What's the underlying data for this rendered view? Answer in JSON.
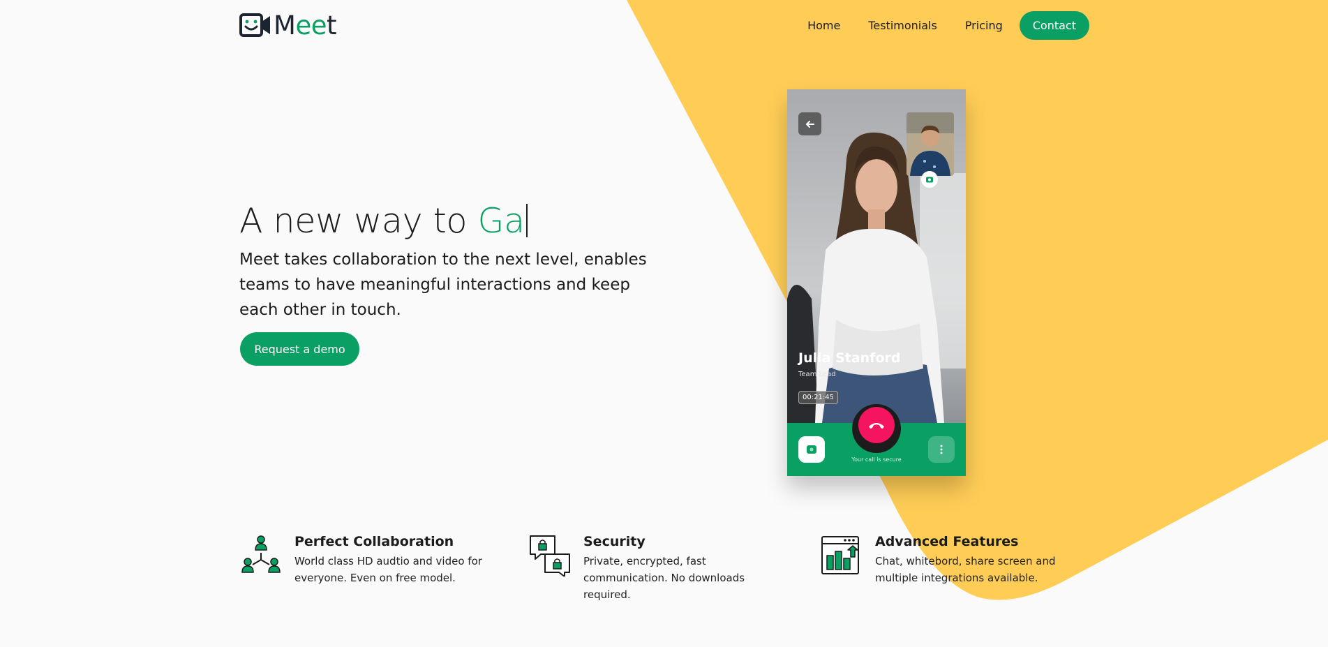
{
  "brand": {
    "logo_prefix": "M",
    "logo_highlight": "ee",
    "logo_suffix": "t",
    "accent": "#0aa063",
    "yellow": "#ffcd56"
  },
  "nav": {
    "home": "Home",
    "testimonials": "Testimonials",
    "pricing": "Pricing",
    "contact": "Contact"
  },
  "hero": {
    "title_static": "A new way to ",
    "title_typed": "Ga",
    "description": "Meet takes collaboration to the next level, enables teams to have meaningful interactions and keep each other in touch.",
    "cta": "Request a demo"
  },
  "call": {
    "caller_name": "Julia Stanford",
    "caller_role": "Team Lead",
    "timer": "00:21:45",
    "secure_text": "Your call is secure",
    "hangup_color": "#f5145f"
  },
  "features": [
    {
      "title": "Perfect Collaboration",
      "text": "World class HD audtio and video for everyone. Even on free model.",
      "icon": "people-network-icon"
    },
    {
      "title": "Security",
      "text": "Private, encrypted, fast communication. No downloads required.",
      "icon": "secure-chat-icon"
    },
    {
      "title": "Advanced Features",
      "text": "Chat, whitebord, share screen and multiple integrations available.",
      "icon": "analytics-window-icon"
    }
  ]
}
